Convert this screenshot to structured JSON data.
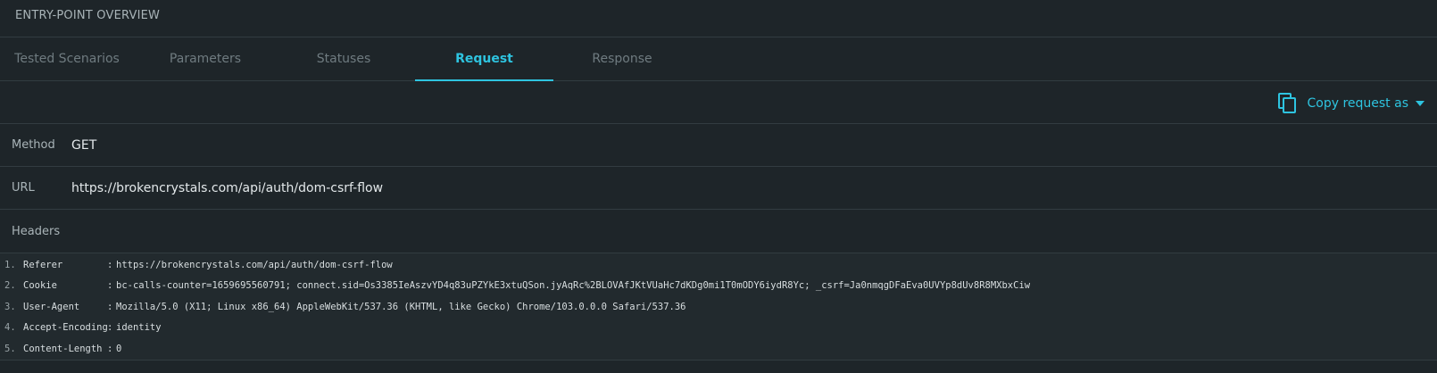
{
  "panel": {
    "title": "ENTRY-POINT OVERVIEW"
  },
  "tabs": [
    {
      "label": "Tested Scenarios"
    },
    {
      "label": "Parameters"
    },
    {
      "label": "Statuses"
    },
    {
      "label": "Request"
    },
    {
      "label": "Response"
    }
  ],
  "active_tab": "Request",
  "toolbar": {
    "copy_label": "Copy request as"
  },
  "request": {
    "method_label": "Method",
    "method": "GET",
    "url_label": "URL",
    "url": "https://brokencrystals.com/api/auth/dom-csrf-flow",
    "headers_label": "Headers",
    "headers": [
      {
        "num": "1.",
        "key": "Referer",
        "sep": ":",
        "value": "https://brokencrystals.com/api/auth/dom-csrf-flow"
      },
      {
        "num": "2.",
        "key": "Cookie",
        "sep": ":",
        "value": "bc-calls-counter=1659695560791; connect.sid=Os3385IeAszvYD4q83uPZYkE3xtuQSon.jyAqRc%2BLOVAfJKtVUaHc7dKDg0mi1T0mODY6iydR8Yc; _csrf=Ja0nmqgDFaEva0UVYp8dUv8R8MXbxCiw"
      },
      {
        "num": "3.",
        "key": "User-Agent",
        "sep": ":",
        "value": "Mozilla/5.0 (X11; Linux x86_64) AppleWebKit/537.36 (KHTML, like Gecko) Chrome/103.0.0.0 Safari/537.36"
      },
      {
        "num": "4.",
        "key": "Accept-Encoding",
        "sep": ":",
        "value": "identity"
      },
      {
        "num": "5.",
        "key": "Content-Length",
        "sep": ":",
        "value": "0"
      }
    ]
  },
  "colors": {
    "accent": "#2ec4e0",
    "background": "#1e2529",
    "divider": "#323c41"
  },
  "icons": {
    "copy": "copy-icon",
    "caret": "caret-down-icon"
  }
}
